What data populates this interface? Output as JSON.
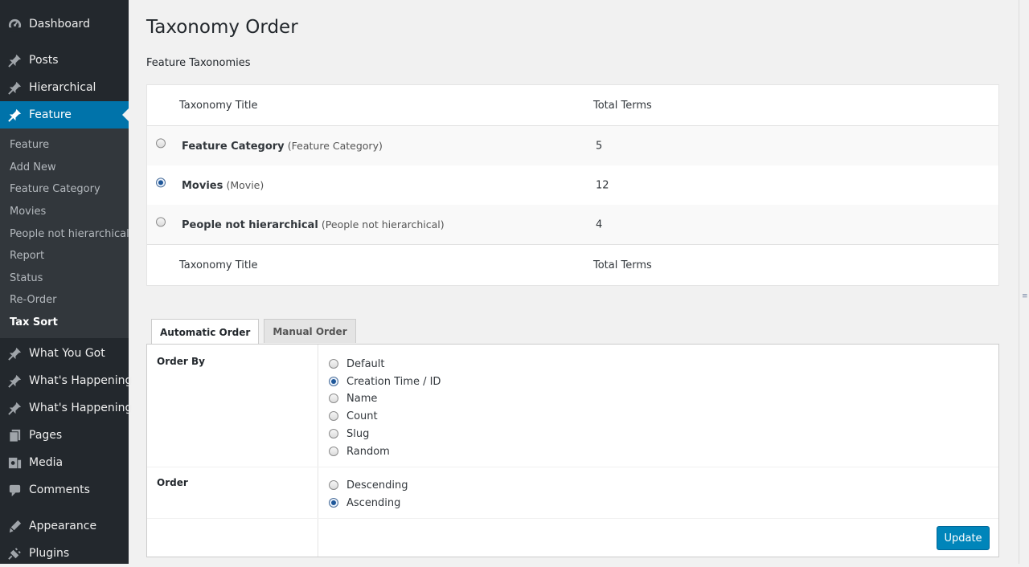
{
  "sidebar": {
    "top_items": [
      {
        "label": "Dashboard",
        "icon": "dashboard-icon"
      },
      {
        "label": "Posts",
        "icon": "pin-icon"
      },
      {
        "label": "Hierarchical",
        "icon": "pin-icon"
      },
      {
        "label": "Feature",
        "icon": "pin-icon"
      }
    ],
    "submenu": [
      "Feature",
      "Add New",
      "Feature Category",
      "Movies",
      "People not hierarchical",
      "Report",
      "Status",
      "Re-Order",
      "Tax Sort"
    ],
    "bottom_items": [
      {
        "label": "What You Got",
        "icon": "pin-icon"
      },
      {
        "label": "What's Happening",
        "icon": "pin-icon"
      },
      {
        "label": "What's Happening",
        "icon": "pin-icon"
      },
      {
        "label": "Pages",
        "icon": "pages-icon"
      },
      {
        "label": "Media",
        "icon": "media-icon"
      },
      {
        "label": "Comments",
        "icon": "comments-icon"
      },
      {
        "label": "Appearance",
        "icon": "appearance-icon"
      },
      {
        "label": "Plugins",
        "icon": "plugins-icon"
      }
    ],
    "colors": {
      "bg": "#23282d",
      "current": "#0073aa",
      "submenu_bg": "#32373c"
    }
  },
  "page": {
    "title": "Taxonomy Order",
    "section_title": "Feature Taxonomies"
  },
  "taxonomy_table": {
    "col_title": "Taxonomy Title",
    "col_total": "Total Terms",
    "rows": [
      {
        "name": "Feature Category",
        "sub": "(Feature Category)",
        "count": "5",
        "checked": false
      },
      {
        "name": "Movies",
        "sub": "(Movie)",
        "count": "12",
        "checked": true
      },
      {
        "name": "People not hierarchical",
        "sub": "(People not hierarchical)",
        "count": "4",
        "checked": false
      }
    ]
  },
  "tabs": {
    "automatic": "Automatic Order",
    "manual": "Manual Order"
  },
  "order_by": {
    "label": "Order By",
    "options": [
      "Default",
      "Creation Time / ID",
      "Name",
      "Count",
      "Slug",
      "Random"
    ],
    "selected": "Creation Time / ID"
  },
  "order": {
    "label": "Order",
    "options": [
      "Descending",
      "Ascending"
    ],
    "selected": "Ascending"
  },
  "update_label": "Update",
  "accent_color": "#0085ba"
}
